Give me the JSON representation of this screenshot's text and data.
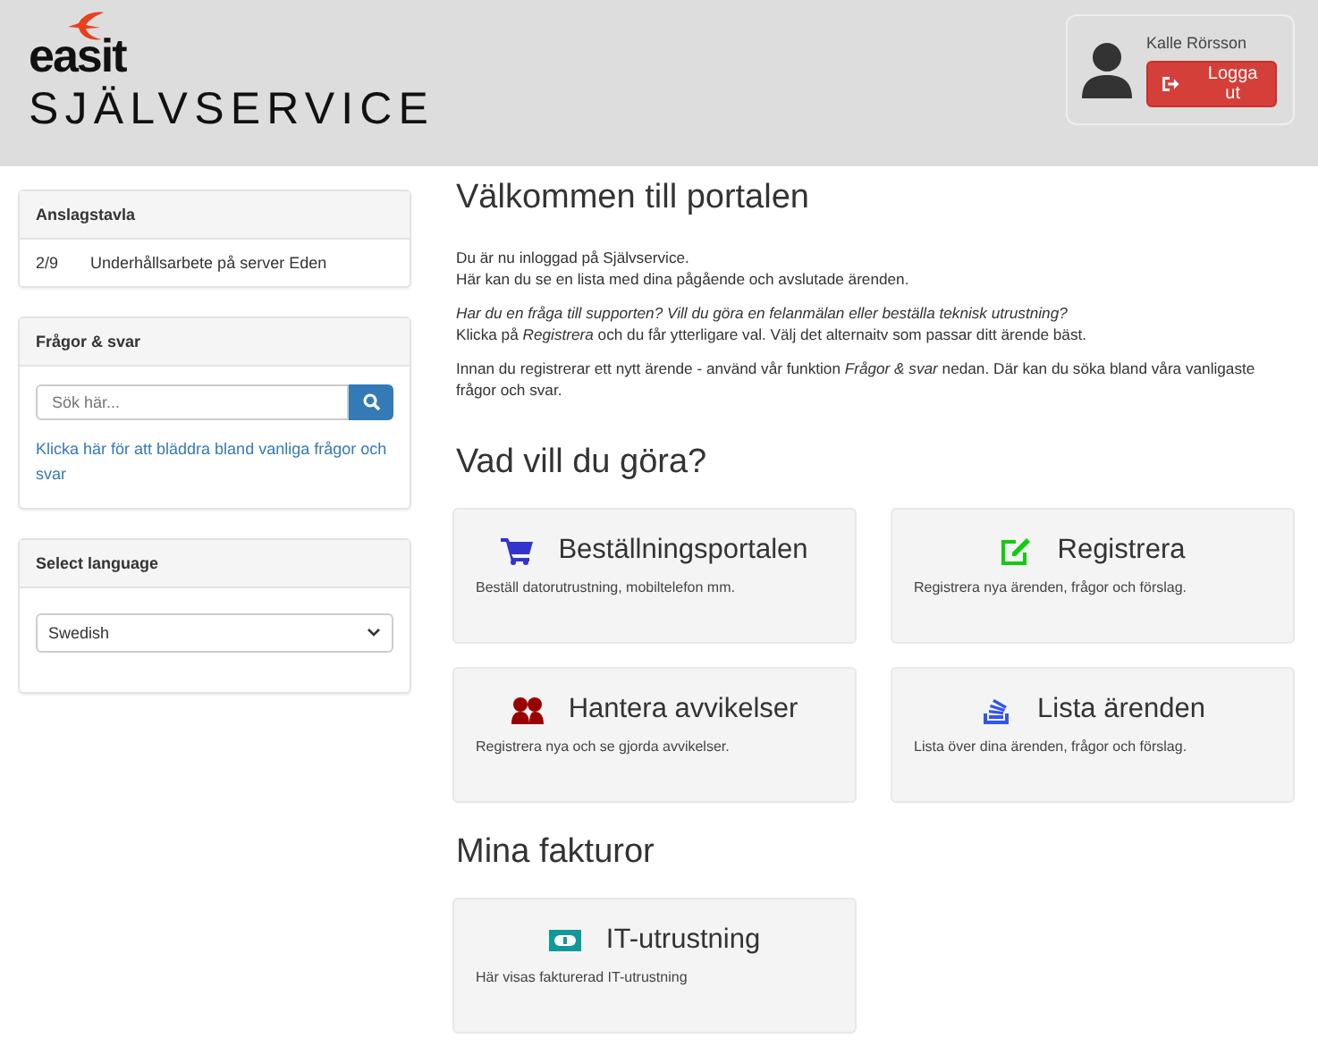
{
  "header": {
    "logo": {
      "name": "easit",
      "subtitle": "SJÄLVSERVICE"
    },
    "user": {
      "name": "Kalle Rörsson",
      "logout": "Logga ut"
    }
  },
  "sidebar": {
    "panels": [
      {
        "kind": "notices",
        "title": "Anslagstavla",
        "items": [
          {
            "date": "2/9",
            "text": "Underhållsarbete på server Eden"
          }
        ]
      },
      {
        "kind": "search",
        "title": "Frågor & svar",
        "placeholder": "Sök här...",
        "link": "Klicka här för att bläddra bland vanliga frågor och svar"
      },
      {
        "kind": "language",
        "title": "Select language",
        "value": "Swedish"
      }
    ]
  },
  "main": {
    "title": "Välkommen till portalen",
    "paragraphs": [
      [
        "Du är nu inloggad på Självservice.",
        "Här kan du se en lista med dina pågående och avslutade ärenden."
      ],
      [
        "*Har du en fråga till supporten? Vill du göra en felanmälan eller beställa teknisk utrustning?*",
        "Klicka på *Registrera* och du får ytterligare val. Välj det alternaitv som passar ditt ärende bäst."
      ],
      [
        "Innan du registrerar ett nytt ärende - använd vår funktion *Frågor & svar* nedan. Där kan du söka bland våra vanligaste frågor och svar."
      ]
    ],
    "sections": [
      {
        "title": "Vad vill du göra?",
        "tiles": [
          {
            "kind": "cart",
            "color": "#3333cc",
            "title": "Beställningsportalen",
            "text": "Beställ datorutrustning, mobiltelefon mm."
          },
          {
            "kind": "edit",
            "color": "#11cc11",
            "title": "Registrera",
            "text": "Registrera nya ärenden, frågor och förslag."
          },
          {
            "kind": "users",
            "color": "#990000",
            "title": "Hantera avvikelser",
            "text": "Registrera nya och se gjorda avvikelser."
          },
          {
            "kind": "list",
            "color": "#3355ee",
            "title": "Lista ärenden",
            "text": "Lista över dina ärenden, frågor och förslag."
          }
        ]
      },
      {
        "title": "Mina fakturor",
        "tiles": [
          {
            "kind": "money",
            "color": "#119999",
            "title": "IT-utrustning",
            "text": "Här visas fakturerad IT-utrustning"
          }
        ]
      }
    ]
  }
}
